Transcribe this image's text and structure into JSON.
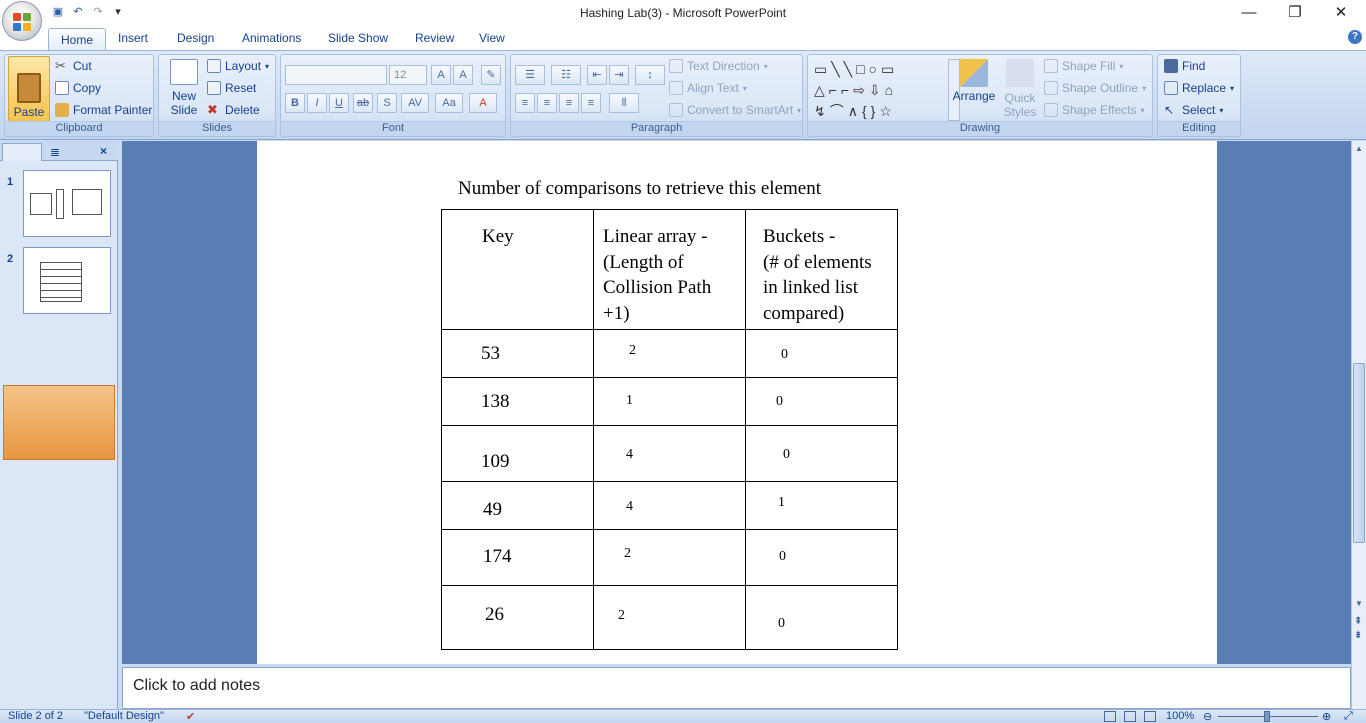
{
  "window": {
    "title": "Hashing Lab(3)  -  Microsoft PowerPoint"
  },
  "qat": {
    "save": "💾",
    "undo": "↶",
    "redo": "↷",
    "customize": "▾"
  },
  "tabs": [
    "Home",
    "Insert",
    "Design",
    "Animations",
    "Slide Show",
    "Review",
    "View"
  ],
  "ribbon": {
    "clipboard": {
      "paste": "Paste",
      "cut": "Cut",
      "copy": "Copy",
      "format_painter": "Format Painter",
      "label": "Clipboard"
    },
    "slides": {
      "new_slide": "New",
      "new_slide2": "Slide",
      "layout": "Layout",
      "reset": "Reset",
      "delete": "Delete",
      "label": "Slides"
    },
    "font": {
      "size": "12",
      "label": "Font"
    },
    "paragraph": {
      "text_direction": "Text Direction",
      "align_text": "Align Text",
      "convert_smartart": "Convert to SmartArt",
      "label": "Paragraph"
    },
    "drawing": {
      "arrange": "Arrange",
      "quick_styles": "Quick",
      "quick_styles2": "Styles",
      "shape_fill": "Shape Fill",
      "shape_outline": "Shape Outline",
      "shape_effects": "Shape Effects",
      "label": "Drawing"
    },
    "editing": {
      "find": "Find",
      "replace": "Replace",
      "select": "Select",
      "label": "Editing"
    }
  },
  "slides_pane": {
    "slide1_num": "1",
    "slide2_num": "2"
  },
  "slide": {
    "title": "Number of comparisons to retrieve this element",
    "headers": {
      "key": "Key",
      "linear": [
        "Linear array -",
        "(Length of",
        "Collision Path",
        "+1)"
      ],
      "buckets": [
        "Buckets -",
        "(# of elements",
        "in  linked list",
        "compared)"
      ]
    },
    "rows": [
      {
        "key": "53",
        "linear": "2",
        "buckets": "0"
      },
      {
        "key": "138",
        "linear": "1",
        "buckets": "0"
      },
      {
        "key": "109",
        "linear": "4",
        "buckets": "0"
      },
      {
        "key": "49",
        "linear": "4",
        "buckets": "1"
      },
      {
        "key": "174",
        "linear": "2",
        "buckets": "0"
      },
      {
        "key": "26",
        "linear": "2",
        "buckets": "0"
      }
    ]
  },
  "notes": {
    "placeholder": "Click to add notes"
  },
  "status": {
    "slide": "Slide 2 of 2",
    "theme": "\"Default Design\"",
    "zoom": "100%"
  },
  "colors": {
    "accent": "#15428b",
    "ribbon": "#dae6f7",
    "workarea": "#5a7db6"
  }
}
